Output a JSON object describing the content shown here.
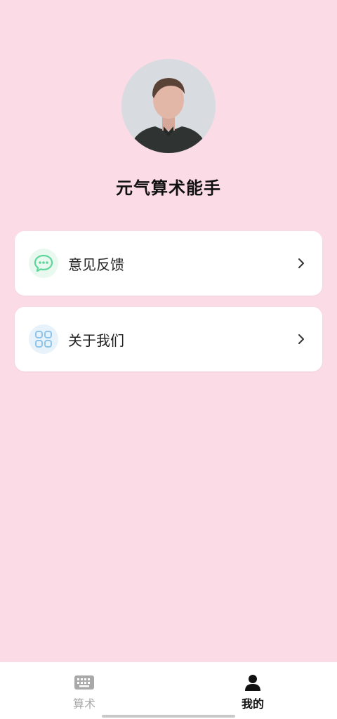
{
  "profile": {
    "username": "元气算术能手"
  },
  "menu": [
    {
      "label": "意见反馈",
      "icon": "chat-bubble-icon",
      "accent": "#5ed69a"
    },
    {
      "label": "关于我们",
      "icon": "grid-icon",
      "accent": "#8ec3ea"
    }
  ],
  "tabbar": {
    "tabs": [
      {
        "label": "算术",
        "icon": "keyboard-icon",
        "active": false
      },
      {
        "label": "我的",
        "icon": "person-icon",
        "active": true
      }
    ]
  },
  "colors": {
    "background": "#fbdbe5",
    "card": "#ffffff",
    "active_tab": "#111111",
    "inactive_tab": "#a9a9a9"
  }
}
